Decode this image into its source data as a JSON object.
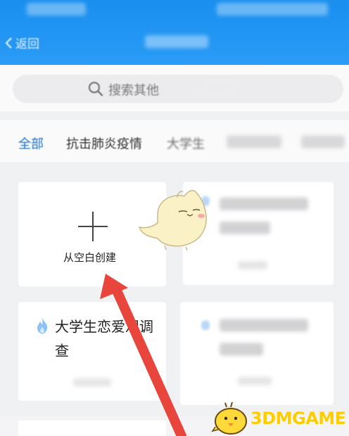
{
  "header": {
    "back_label": "返回"
  },
  "search": {
    "placeholder": "搜索其他"
  },
  "tabs": [
    {
      "label": "全部",
      "active": true
    },
    {
      "label": "抗击肺炎疫情",
      "active": false
    },
    {
      "label": "大学生",
      "active": false
    }
  ],
  "cards": {
    "create_label": "从空白创建",
    "template_title": "大学生恋爱观调查"
  },
  "watermark": {
    "text": "3DMGAME"
  },
  "colors": {
    "header_blue": "#1a8ff0",
    "active_tab": "#1a73c8",
    "arrow_red": "#e8453c",
    "watermark_yellow": "#ffcc00"
  },
  "icons": [
    "chevron-left-icon",
    "search-icon",
    "plus-icon",
    "fire-icon"
  ]
}
